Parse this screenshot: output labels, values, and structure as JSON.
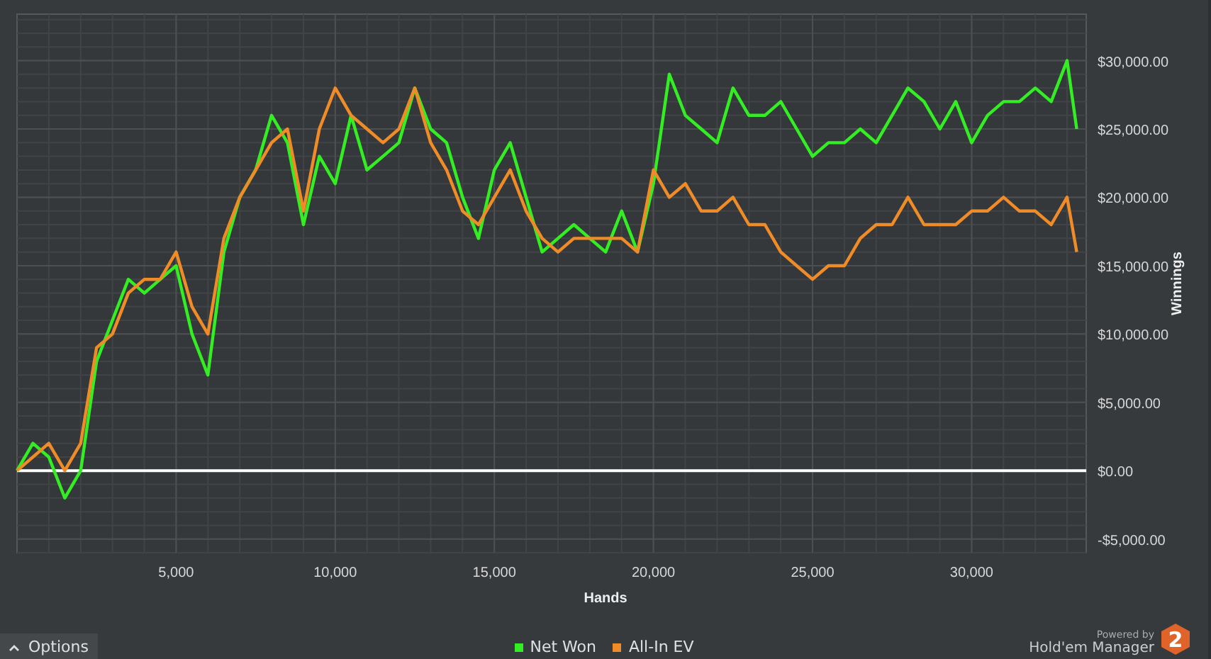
{
  "chart": {
    "chart_data": {
      "type": "line",
      "grid": true,
      "xlabel": "Hands",
      "ylabel": "Winnings",
      "x": [
        0,
        500,
        1000,
        1500,
        2000,
        2500,
        3000,
        3500,
        4000,
        4500,
        5000,
        5500,
        6000,
        6500,
        7000,
        7500,
        8000,
        8500,
        9000,
        9500,
        10000,
        10500,
        11000,
        11500,
        12000,
        12500,
        13000,
        13500,
        14000,
        14500,
        15000,
        15500,
        16000,
        16500,
        17000,
        17500,
        18000,
        18500,
        19000,
        19500,
        20000,
        20500,
        21000,
        21500,
        22000,
        22500,
        23000,
        23500,
        24000,
        24500,
        25000,
        25500,
        26000,
        26500,
        27000,
        27500,
        28000,
        28500,
        29000,
        29500,
        30000,
        30500,
        31000,
        31500,
        32000,
        32500,
        33000,
        33300
      ],
      "series": [
        {
          "name": "Net Won",
          "color": "#33ee22",
          "values": [
            0,
            2000,
            1000,
            -2000,
            0,
            8000,
            11000,
            14000,
            13000,
            14000,
            15000,
            10000,
            7000,
            16000,
            20000,
            22000,
            26000,
            24000,
            18000,
            23000,
            21000,
            26000,
            22000,
            23000,
            24000,
            28000,
            25000,
            24000,
            20000,
            17000,
            22000,
            24000,
            20000,
            16000,
            17000,
            18000,
            17000,
            16000,
            19000,
            16000,
            21000,
            29000,
            26000,
            25000,
            24000,
            28000,
            26000,
            26000,
            27000,
            25000,
            23000,
            24000,
            24000,
            25000,
            24000,
            26000,
            28000,
            27000,
            25000,
            27000,
            24000,
            26000,
            27000,
            27000,
            28000,
            27000,
            30000,
            25000
          ]
        },
        {
          "name": "All-In EV",
          "color": "#f08c28",
          "values": [
            0,
            1000,
            2000,
            0,
            2000,
            9000,
            10000,
            13000,
            14000,
            14000,
            16000,
            12000,
            10000,
            17000,
            20000,
            22000,
            24000,
            25000,
            19000,
            25000,
            28000,
            26000,
            25000,
            24000,
            25000,
            28000,
            24000,
            22000,
            19000,
            18000,
            20000,
            22000,
            19000,
            17000,
            16000,
            17000,
            17000,
            17000,
            17000,
            16000,
            22000,
            20000,
            21000,
            19000,
            19000,
            20000,
            18000,
            18000,
            16000,
            15000,
            14000,
            15000,
            15000,
            17000,
            18000,
            18000,
            20000,
            18000,
            18000,
            18000,
            19000,
            19000,
            20000,
            19000,
            19000,
            18000,
            20000,
            16000
          ]
        }
      ],
      "xlim": [
        0,
        33600
      ],
      "ylim": [
        -6000,
        33400
      ],
      "xticks": [
        {
          "value": 5000,
          "label": "5,000"
        },
        {
          "value": 10000,
          "label": "10,000"
        },
        {
          "value": 15000,
          "label": "15,000"
        },
        {
          "value": 20000,
          "label": "20,000"
        },
        {
          "value": 25000,
          "label": "25,000"
        },
        {
          "value": 30000,
          "label": "30,000"
        }
      ],
      "yticks": [
        {
          "value": -5000,
          "label": "-$5,000.00"
        },
        {
          "value": 0,
          "label": "$0.00"
        },
        {
          "value": 5000,
          "label": "$5,000.00"
        },
        {
          "value": 10000,
          "label": "$10,000.00"
        },
        {
          "value": 15000,
          "label": "$15,000.00"
        },
        {
          "value": 20000,
          "label": "$20,000.00"
        },
        {
          "value": 25000,
          "label": "$25,000.00"
        },
        {
          "value": 30000,
          "label": "$30,000.00"
        }
      ]
    }
  },
  "options_button": {
    "label": "Options"
  },
  "branding": {
    "caption": "Powered by",
    "name": "Hold'em Manager",
    "badge": "2"
  }
}
